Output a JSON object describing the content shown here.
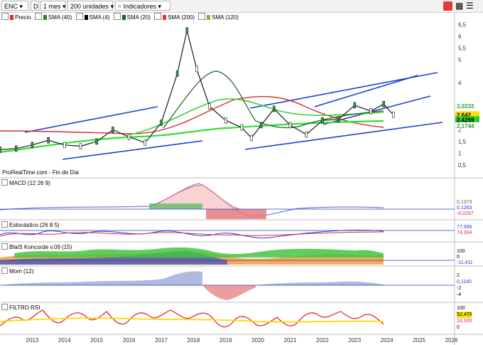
{
  "toolbar": {
    "symbol": "ENC",
    "d_label": "D",
    "period": "1 mes",
    "units": "200 unidades",
    "indicators": "Indicadores"
  },
  "legend": [
    {
      "label": "Precio",
      "color": "#d32f2f"
    },
    {
      "label": "SMA (40)",
      "color": "#2e7d32"
    },
    {
      "label": "SMA (4)",
      "color": "#000000"
    },
    {
      "label": "SMA (20)",
      "color": "#1b5e20"
    },
    {
      "label": "SMA (200)",
      "color": "#e53935"
    },
    {
      "label": "SMA (120)",
      "color": "#7cb342"
    }
  ],
  "credit": "ProRealTime.com - Fin de Día",
  "panels": {
    "macd": {
      "title": "MACD (12 26 9)",
      "labels": [
        "0,1373",
        "0,1263",
        "-0,0167"
      ]
    },
    "stoch": {
      "title": "Estocástico (26 8 5)",
      "labels": [
        "77,066",
        "74,304"
      ]
    },
    "koncorde": {
      "title": "BlaiS Koncorde v.09 (15)",
      "labels": [
        "100",
        "0",
        "-11,411"
      ]
    },
    "mom": {
      "title": "Mom (12)",
      "labels": [
        "2",
        "0,1140",
        "-2",
        "-4"
      ]
    },
    "rsi": {
      "title": "FILTRO RSI",
      "labels": [
        "100",
        "52,470",
        "24,100",
        "0"
      ]
    }
  },
  "colors": {
    "accent_blue": "#1f3fd1",
    "price_badge": "#ffe000",
    "sma_badge": "#33cc33",
    "last_value_green": "#2e9e44"
  },
  "chart_data": {
    "type": "line",
    "title": "",
    "xlabel": "",
    "ylabel": "",
    "x": [
      2012.5,
      2013.0,
      2013.5,
      2014.0,
      2014.5,
      2015.0,
      2015.5,
      2016.0,
      2016.5,
      2017.0,
      2017.5,
      2018.0,
      2018.3,
      2018.6,
      2019.0,
      2019.5,
      2020.0,
      2020.3,
      2020.6,
      2021.0,
      2021.5,
      2022.0,
      2022.5,
      2023.0,
      2023.5,
      2024.0,
      2024.4,
      2024.7
    ],
    "series": [
      {
        "name": "Precio",
        "values": [
          1.15,
          1.2,
          1.35,
          1.55,
          1.35,
          1.3,
          1.5,
          2.0,
          1.7,
          1.45,
          2.3,
          4.4,
          6.25,
          4.6,
          3.0,
          2.4,
          2.1,
          1.65,
          2.2,
          2.9,
          2.2,
          1.8,
          2.4,
          2.45,
          3.05,
          2.8,
          3.1,
          2.64
        ]
      }
    ],
    "xticks": [
      "2013",
      "2014",
      "2015",
      "2016",
      "2017",
      "2018",
      "2019",
      "2020",
      "2021",
      "2022",
      "2023",
      "2024",
      "2025",
      "2026"
    ],
    "yticks": [
      "6,5",
      "6",
      "5,5",
      "5",
      "4",
      "3",
      "2",
      "1,5",
      "1",
      "0,5"
    ],
    "ylim": [
      0.25,
      6.7
    ],
    "xlim": [
      2012.5,
      2026.6
    ],
    "right_labels": [
      {
        "text": "3,0233",
        "value": 3.02,
        "color": "#ffffff"
      },
      {
        "text": "2,642",
        "value": 2.64,
        "color": "#ffe000"
      },
      {
        "text": "2,4259",
        "value": 2.43,
        "color": "#33cc33"
      },
      {
        "text": "2,1744",
        "value": 2.17,
        "color": "#ffffff"
      }
    ],
    "grid": false,
    "legend": "top-left"
  }
}
